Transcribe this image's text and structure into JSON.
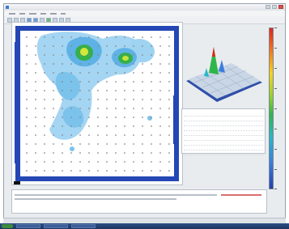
{
  "window": {
    "title": "",
    "menu": [],
    "controls": [
      "minimize-icon",
      "maximize-icon",
      "close-icon"
    ]
  },
  "toolbar": {
    "buttons": [
      "open-icon",
      "save-icon",
      "print-icon",
      "zoom-in-icon",
      "zoom-out-icon",
      "grid-icon",
      "map-icon",
      "settings-icon",
      "play-icon",
      "stop-icon"
    ]
  },
  "heatmap": {
    "description_colors": {
      "low": "#2b4fb5",
      "mid": "#62b6e6",
      "high": "#36b74a",
      "peak": "#d7e63c"
    },
    "frame_color": "#2447b5",
    "grid_dot_color": "#888888"
  },
  "legend": {
    "colors": [
      "#e3221c",
      "#f26b1d",
      "#f7d21c",
      "#9ad22e",
      "#2fb64a",
      "#27b8c8",
      "#3b7ddd",
      "#243fb0"
    ]
  },
  "info_panel": {
    "rows": [
      {
        "label": "",
        "value": ""
      },
      {
        "label": "",
        "value": ""
      },
      {
        "label": "",
        "value": ""
      },
      {
        "label": "",
        "value": ""
      },
      {
        "label": "",
        "value": ""
      },
      {
        "label": "",
        "value": ""
      },
      {
        "label": "",
        "value": ""
      },
      {
        "label": "",
        "value": ""
      },
      {
        "label": "",
        "value": ""
      }
    ]
  },
  "taskbar": {
    "clock": ""
  }
}
